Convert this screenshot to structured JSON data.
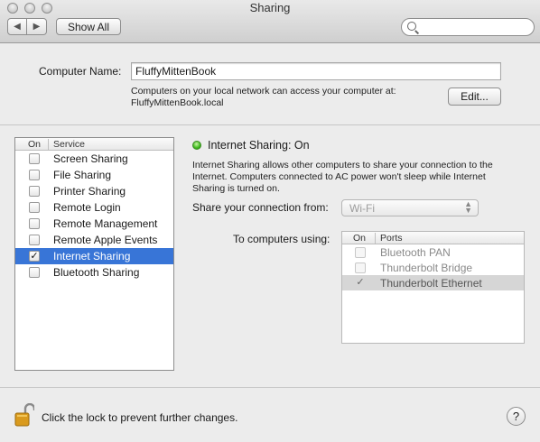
{
  "window": {
    "title": "Sharing"
  },
  "toolbar": {
    "back_glyph": "◀",
    "forward_glyph": "▶",
    "show_all_label": "Show All",
    "search_placeholder": ""
  },
  "computer": {
    "name_label": "Computer Name:",
    "name_value": "FluffyMittenBook",
    "access_note_line1": "Computers on your local network can access your computer at:",
    "access_note_line2": "FluffyMittenBook.local",
    "edit_label": "Edit..."
  },
  "services": {
    "header_on": "On",
    "header_service": "Service",
    "items": [
      {
        "name": "Screen Sharing",
        "checked": false,
        "selected": false
      },
      {
        "name": "File Sharing",
        "checked": false,
        "selected": false
      },
      {
        "name": "Printer Sharing",
        "checked": false,
        "selected": false
      },
      {
        "name": "Remote Login",
        "checked": false,
        "selected": false
      },
      {
        "name": "Remote Management",
        "checked": false,
        "selected": false
      },
      {
        "name": "Remote Apple Events",
        "checked": false,
        "selected": false
      },
      {
        "name": "Internet Sharing",
        "checked": true,
        "selected": true
      },
      {
        "name": "Bluetooth Sharing",
        "checked": false,
        "selected": false
      }
    ]
  },
  "detail": {
    "status_title": "Internet Sharing: On",
    "status_color": "#3db91c",
    "description_line1": "Internet Sharing allows other computers to share your connection to the",
    "description_line2": "Internet. Computers connected to AC power won't sleep while Internet",
    "description_line3": "Sharing is turned on.",
    "share_from_label": "Share your connection from:",
    "share_from_value": "Wi-Fi",
    "to_computers_label": "To computers using:",
    "ports_header_on": "On",
    "ports_header_ports": "Ports",
    "ports": [
      {
        "name": "Bluetooth PAN",
        "checked": false,
        "selected": false
      },
      {
        "name": "Thunderbolt Bridge",
        "checked": false,
        "selected": false
      },
      {
        "name": "Thunderbolt Ethernet",
        "checked": true,
        "selected": true
      }
    ]
  },
  "footer": {
    "lock_text": "Click the lock to prevent further changes.",
    "help_glyph": "?"
  },
  "colors": {
    "selection": "#3875d7",
    "window_bg": "#ececec",
    "lock_gold": "#d99a1e"
  }
}
